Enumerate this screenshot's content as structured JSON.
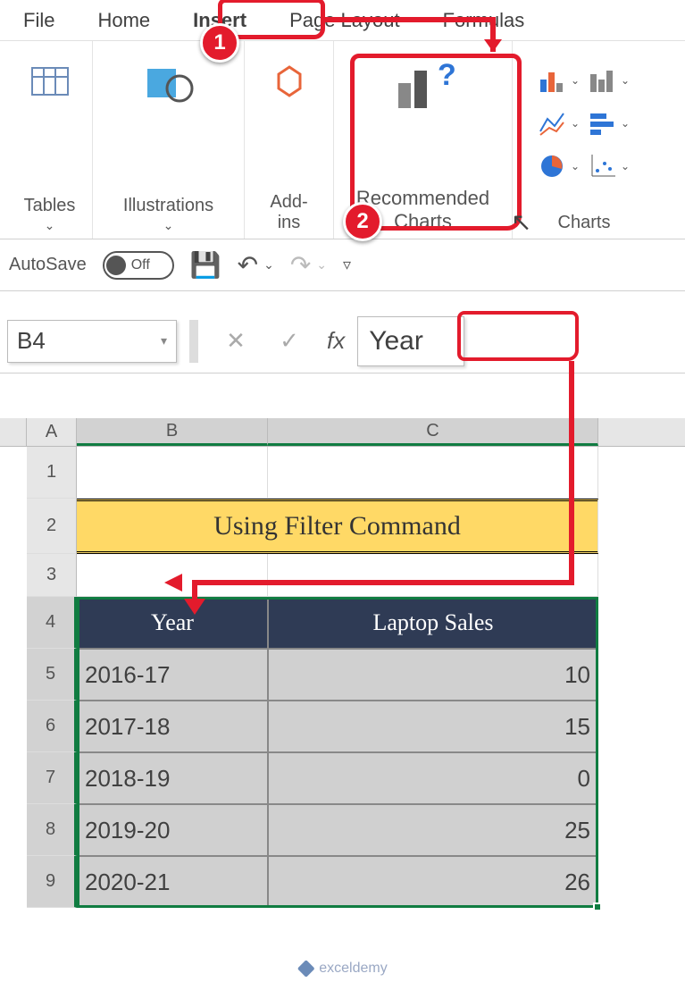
{
  "tabs": {
    "file": "File",
    "home": "Home",
    "insert": "Insert",
    "page_layout": "Page Layout",
    "formulas": "Formulas"
  },
  "ribbon": {
    "tables": "Tables",
    "illustrations": "Illustrations",
    "addins": "Add-\nins",
    "recommended": "Recommended\nCharts",
    "charts": "Charts"
  },
  "callouts": {
    "one": "1",
    "two": "2"
  },
  "qat": {
    "autosave": "AutoSave",
    "off": "Off"
  },
  "fx": {
    "cell_ref": "B4",
    "value": "Year",
    "fx": "fx"
  },
  "cols": {
    "a": "A",
    "b": "B",
    "c": "C"
  },
  "rows": {
    "r1": "1",
    "r2": "2",
    "r3": "3",
    "r4": "4",
    "r5": "5",
    "r6": "6",
    "r7": "7",
    "r8": "8",
    "r9": "9"
  },
  "sheet": {
    "title": "Using Filter Command",
    "h_year": "Year",
    "h_sales": "Laptop Sales"
  },
  "data": {
    "y0": "2016-17",
    "v0": "10",
    "y1": "2017-18",
    "v1": "15",
    "y2": "2018-19",
    "v2": "0",
    "y3": "2019-20",
    "v3": "25",
    "y4": "2020-21",
    "v4": "26"
  },
  "chart_data": {
    "type": "table",
    "title": "Using Filter Command",
    "columns": [
      "Year",
      "Laptop Sales"
    ],
    "rows": [
      [
        "2016-17",
        10
      ],
      [
        "2017-18",
        15
      ],
      [
        "2018-19",
        0
      ],
      [
        "2019-20",
        25
      ],
      [
        "2020-21",
        26
      ]
    ]
  },
  "watermark": "exceldemy"
}
